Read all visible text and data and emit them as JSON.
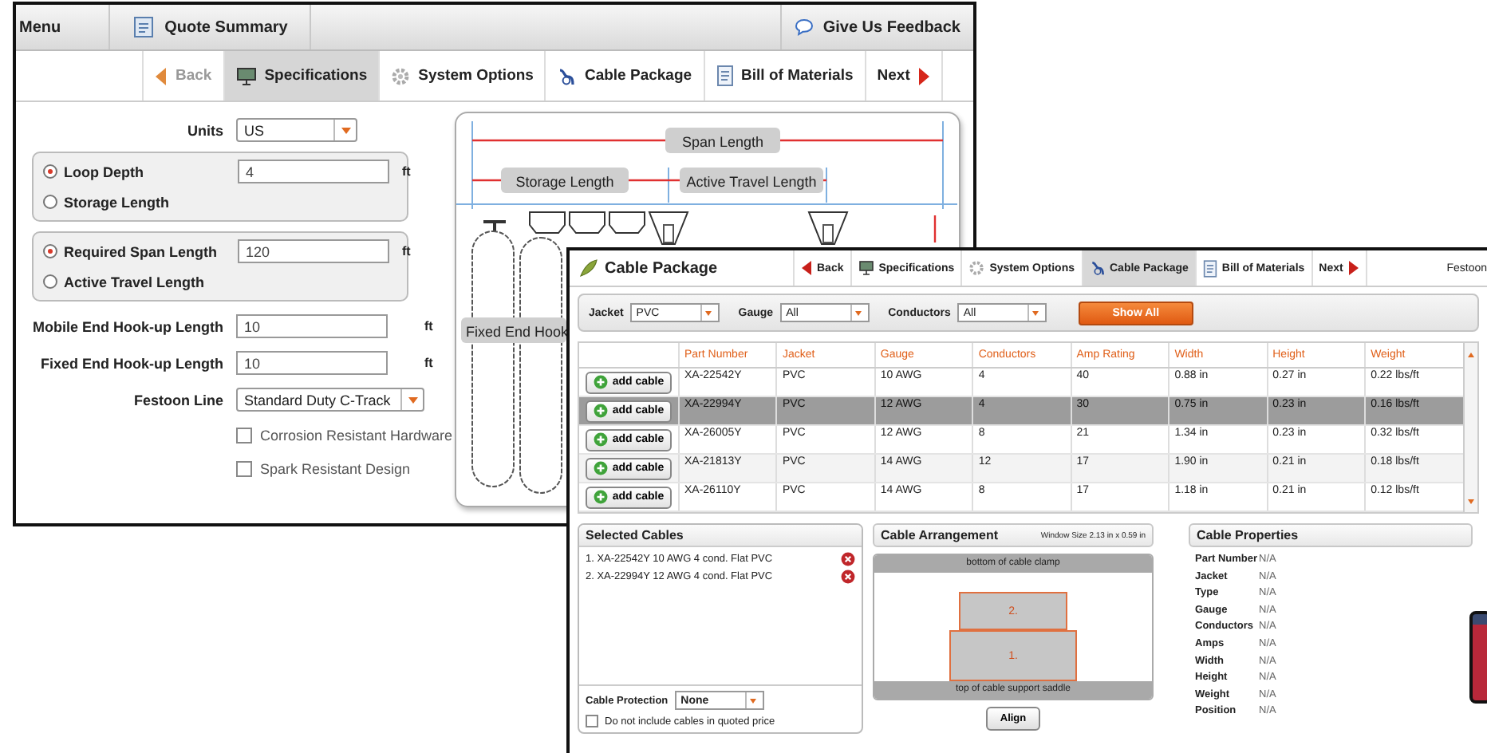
{
  "back_window": {
    "toolbar": {
      "menu": "Menu",
      "quote_summary": "Quote Summary",
      "feedback": "Give Us Feedback"
    },
    "nav": [
      {
        "label": "Back",
        "kind": "back",
        "selected": false
      },
      {
        "label": "Specifications",
        "kind": "tab",
        "selected": true
      },
      {
        "label": "System Options",
        "kind": "tab",
        "selected": false
      },
      {
        "label": "Cable Package",
        "kind": "tab",
        "selected": false
      },
      {
        "label": "Bill of Materials",
        "kind": "tab",
        "selected": false
      },
      {
        "label": "Next",
        "kind": "next",
        "selected": false
      }
    ],
    "units": {
      "label": "Units",
      "value": "US"
    },
    "radio_groups": [
      {
        "options": [
          {
            "label": "Loop Depth",
            "selected": true,
            "value": "4",
            "unit": "ft"
          },
          {
            "label": "Storage Length",
            "selected": false
          }
        ]
      },
      {
        "options": [
          {
            "label": "Required Span Length",
            "selected": true,
            "value": "120",
            "unit": "ft"
          },
          {
            "label": "Active Travel Length",
            "selected": false
          }
        ]
      }
    ],
    "fields": [
      {
        "label": "Mobile End Hook-up Length",
        "value": "10",
        "unit": "ft"
      },
      {
        "label": "Fixed End Hook-up Length",
        "value": "10",
        "unit": "ft"
      }
    ],
    "festoon_line": {
      "label": "Festoon Line",
      "value": "Standard Duty C-Track"
    },
    "checkboxes": [
      {
        "label": "Corrosion Resistant Hardware",
        "checked": false
      },
      {
        "label": "Spark Resistant Design",
        "checked": false
      }
    ],
    "diagram": {
      "span_label": "Span Length",
      "storage_label": "Storage Length",
      "travel_label": "Active Travel Length",
      "hookup_label": "Fixed End Hook"
    }
  },
  "front_window": {
    "title": "Cable Package",
    "nav": [
      {
        "label": "Back",
        "kind": "back",
        "selected": false
      },
      {
        "label": "Specifications",
        "kind": "tab",
        "selected": false
      },
      {
        "label": "System Options",
        "kind": "tab",
        "selected": false
      },
      {
        "label": "Cable Package",
        "kind": "tab",
        "selected": true
      },
      {
        "label": "Bill of Materials",
        "kind": "tab",
        "selected": false
      },
      {
        "label": "Next",
        "kind": "next",
        "selected": false
      }
    ],
    "header_right": "Festoon",
    "filters": [
      {
        "label": "Jacket",
        "value": "PVC"
      },
      {
        "label": "Gauge",
        "value": "All"
      },
      {
        "label": "Conductors",
        "value": "All"
      }
    ],
    "show_all": "Show All",
    "table": {
      "columns": [
        "Part Number",
        "Jacket",
        "Gauge",
        "Conductors",
        "Amp Rating",
        "Width",
        "Height",
        "Weight"
      ],
      "rows": [
        {
          "selected": false,
          "button": "add cable",
          "cells": [
            "XA-22542Y",
            "PVC",
            "10 AWG",
            "4",
            "40",
            "0.88 in",
            "0.27 in",
            "0.22 lbs/ft"
          ]
        },
        {
          "selected": true,
          "button": "add cable",
          "cells": [
            "XA-22994Y",
            "PVC",
            "12 AWG",
            "4",
            "30",
            "0.75 in",
            "0.23 in",
            "0.16 lbs/ft"
          ]
        },
        {
          "selected": false,
          "button": "add cable",
          "cells": [
            "XA-26005Y",
            "PVC",
            "12 AWG",
            "8",
            "21",
            "1.34 in",
            "0.23 in",
            "0.32 lbs/ft"
          ]
        },
        {
          "selected": false,
          "button": "add cable",
          "cells": [
            "XA-21813Y",
            "PVC",
            "14 AWG",
            "12",
            "17",
            "1.90 in",
            "0.21 in",
            "0.18 lbs/ft"
          ]
        },
        {
          "selected": false,
          "button": "add cable",
          "cells": [
            "XA-26110Y",
            "PVC",
            "14 AWG",
            "8",
            "17",
            "1.18 in",
            "0.21 in",
            "0.12 lbs/ft"
          ]
        }
      ]
    },
    "selected_cables": {
      "title": "Selected Cables",
      "items": [
        "1. XA-22542Y 10 AWG 4 cond. Flat PVC",
        "2. XA-22994Y 12 AWG 4 cond. Flat PVC"
      ],
      "protection": {
        "label": "Cable Protection",
        "value": "None"
      },
      "exclude": {
        "label": "Do not include cables in quoted price",
        "checked": false
      }
    },
    "arrangement": {
      "title": "Cable Arrangement",
      "window_size": "Window Size 2.13 in x 0.59 in",
      "top_label": "bottom of cable clamp",
      "blocks": [
        "2.",
        "1."
      ],
      "bottom_label": "top of cable support saddle",
      "align": "Align"
    },
    "properties": {
      "title": "Cable Properties",
      "rows": [
        {
          "name": "Part Number",
          "value": "N/A"
        },
        {
          "name": "Jacket",
          "value": "N/A"
        },
        {
          "name": "Type",
          "value": "N/A"
        },
        {
          "name": "Gauge",
          "value": "N/A"
        },
        {
          "name": "Conductors",
          "value": "N/A"
        },
        {
          "name": "Amps",
          "value": "N/A"
        },
        {
          "name": "Width",
          "value": "N/A"
        },
        {
          "name": "Height",
          "value": "N/A"
        },
        {
          "name": "Weight",
          "value": "N/A"
        },
        {
          "name": "Position",
          "value": "N/A"
        }
      ]
    }
  }
}
